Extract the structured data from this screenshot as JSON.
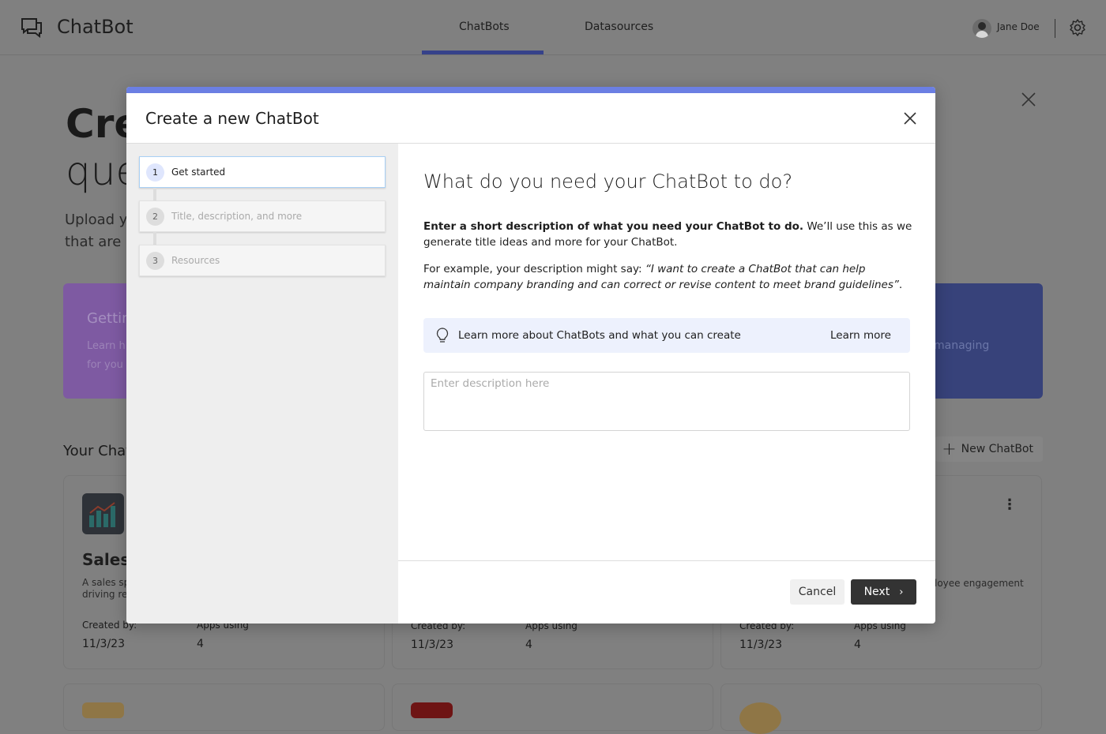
{
  "app": {
    "title": "ChatBot",
    "tabs": [
      {
        "label": "ChatBots",
        "active": true
      },
      {
        "label": "Datasources",
        "active": false
      }
    ],
    "user": "Jane Doe"
  },
  "background": {
    "heading_line1": "Cre",
    "heading_line2": "que",
    "intro_line1": "Upload y",
    "intro_line2": "that are s",
    "promo_left": {
      "title": "Gettin",
      "line1": "Learn h",
      "line2": "for you"
    },
    "promo_right": {
      "line": "managing"
    },
    "section_title": "Your Chat",
    "new_button": "New ChatBot",
    "cards": [
      {
        "title": "Sales",
        "desc1": "A sales sp",
        "desc2": "driving rev",
        "created_label": "Created by:",
        "created": "11/3/23",
        "apps_label": "Apps using",
        "apps": "4"
      },
      {
        "created_label": "Created by:",
        "created": "11/3/23",
        "apps_label": "Apps using",
        "apps": "4"
      },
      {
        "desc1": "loyee engagement",
        "created_label": "Created by:",
        "created": "11/3/23",
        "apps_label": "Apps using",
        "apps": "4"
      }
    ]
  },
  "modal": {
    "title": "Create a new ChatBot",
    "steps": [
      {
        "n": "1",
        "label": "Get started"
      },
      {
        "n": "2",
        "label": "Title, description, and more"
      },
      {
        "n": "3",
        "label": "Resources"
      }
    ],
    "question": "What do you need your ChatBot to do?",
    "intro_bold": "Enter a short description of what you need your ChatBot to do.",
    "intro_rest": " We’ll use this as we generate title ideas and more for your ChatBot.",
    "example_prefix": "For example, your description might say: ",
    "example_quote": "“I want to create a ChatBot that can help maintain company branding and can correct or revise content to meet brand guidelines”",
    "example_suffix": ".",
    "tip_text": "Learn more about ChatBots and what you can create",
    "tip_link": "Learn more",
    "description_placeholder": "Enter description here",
    "description_value": "",
    "cancel": "Cancel",
    "next": "Next"
  },
  "colors": {
    "accent": "#6b7fe3",
    "primary_button": "#333333",
    "tip_bg": "#edf1fd"
  }
}
